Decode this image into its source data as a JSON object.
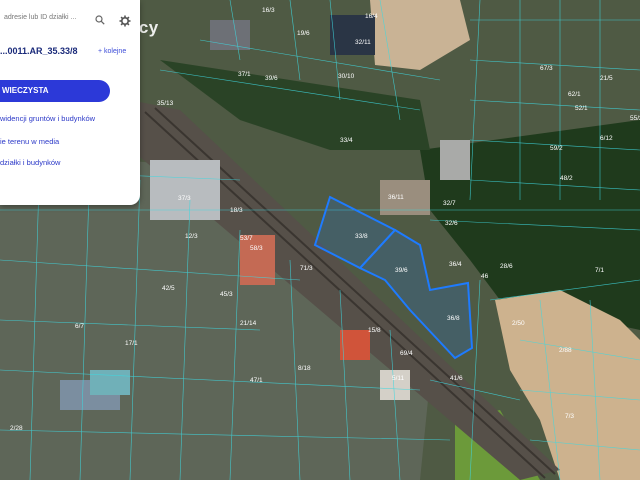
{
  "search": {
    "placeholder": "adresie lub ID działki ..."
  },
  "parcel": {
    "id": "...0011.AR_35.33/8",
    "extra": "+ kolejne"
  },
  "actions": {
    "main_button": "WIECZYSTA"
  },
  "links": [
    "widencji gruntów i budynków",
    "ie terenu w media",
    "działki i budynków"
  ],
  "brand": {
    "text": "adcy"
  },
  "map": {
    "selected_parcel_color": "#1e7bff",
    "parcel_line_color": "#3fd8e0",
    "labels": [
      "16/3",
      "16/4",
      "19/6",
      "32/11",
      "30/10",
      "39/6",
      "37/1",
      "35/13",
      "33/4",
      "36/11",
      "33/8",
      "32/7",
      "32/6",
      "36/4",
      "39/6",
      "46",
      "28/6",
      "36/8",
      "2/50",
      "2/88",
      "7/3",
      "7/1",
      "62/1",
      "21/5",
      "67/3",
      "59/2",
      "48/2",
      "55/2",
      "6/12",
      "52/1",
      "53/7",
      "58/3",
      "45/3",
      "71/3",
      "21/14",
      "37/3",
      "12/3",
      "14/8",
      "18/3",
      "2/28",
      "6/7",
      "17/1",
      "42/5",
      "47/1",
      "8/18",
      "5/11",
      "69/4",
      "41/6",
      "15/8"
    ]
  },
  "icons": {
    "search": "search-icon",
    "settings": "gear-icon"
  }
}
